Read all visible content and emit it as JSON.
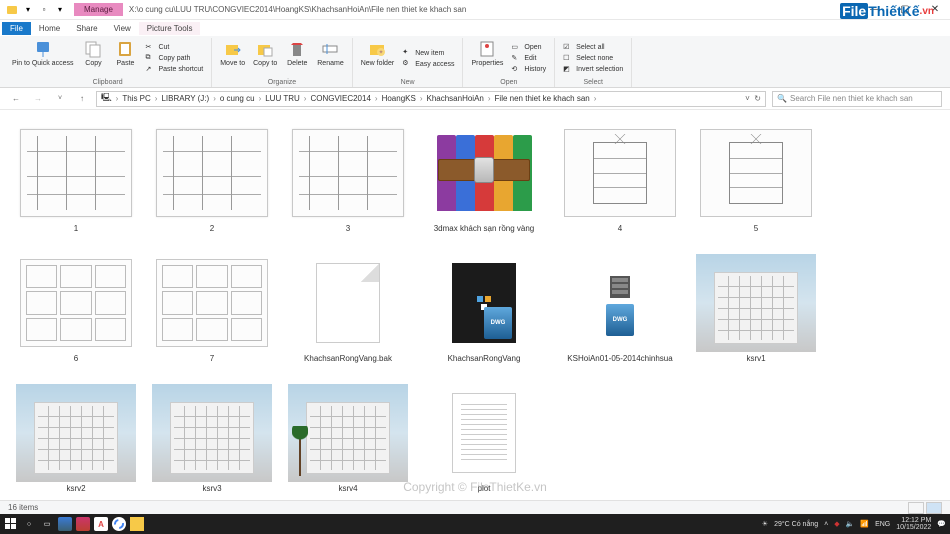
{
  "window": {
    "title_path": "X:\\o cung cu\\LUU TRU\\CONGVIEC2014\\HoangKS\\KhachsanHoiAn\\File nen thiet ke khach san",
    "ctx_tab": "Manage"
  },
  "ribbon": {
    "tabs": {
      "file": "File",
      "home": "Home",
      "share": "Share",
      "view": "View",
      "picture": "Picture Tools"
    },
    "pin": "Pin to Quick access",
    "copy": "Copy",
    "paste": "Paste",
    "cut": "Cut",
    "copypath": "Copy path",
    "pasteshortcut": "Paste shortcut",
    "clipboard": "Clipboard",
    "moveto": "Move to",
    "copyto": "Copy to",
    "delete": "Delete",
    "rename": "Rename",
    "organize": "Organize",
    "newfolder": "New folder",
    "newitem": "New item",
    "easyaccess": "Easy access",
    "new": "New",
    "properties": "Properties",
    "open": "Open",
    "edit": "Edit",
    "history": "History",
    "openg": "Open",
    "selectall": "Select all",
    "selectnone": "Select none",
    "invert": "Invert selection",
    "select": "Select"
  },
  "breadcrumb": {
    "root": "This PC",
    "parts": [
      "LIBRARY (J:)",
      "o cung cu",
      "LUU TRU",
      "CONGVIEC2014",
      "HoangKS",
      "KhachsanHoiAn",
      "File nen thiet ke khach san"
    ]
  },
  "search": {
    "placeholder": "Search File nen thiet ke khach san"
  },
  "files": [
    {
      "name": "1",
      "kind": "plan"
    },
    {
      "name": "2",
      "kind": "plan"
    },
    {
      "name": "3",
      "kind": "plan"
    },
    {
      "name": "3dmax khách sạn rồng vàng",
      "kind": "winrar"
    },
    {
      "name": "4",
      "kind": "elev"
    },
    {
      "name": "5",
      "kind": "elev"
    },
    {
      "name": "6",
      "kind": "grid"
    },
    {
      "name": "7",
      "kind": "grid"
    },
    {
      "name": "KhachsanRongVang.bak",
      "kind": "bak"
    },
    {
      "name": "KhachsanRongVang",
      "kind": "dwgdark"
    },
    {
      "name": "KSHoiAn01-05-2014chinhsua",
      "kind": "dwg"
    },
    {
      "name": "ksrv1",
      "kind": "render"
    },
    {
      "name": "ksrv2",
      "kind": "render"
    },
    {
      "name": "ksrv3",
      "kind": "render"
    },
    {
      "name": "ksrv4",
      "kind": "renderpalm"
    },
    {
      "name": "plot",
      "kind": "plot"
    }
  ],
  "status": {
    "count": "16 items"
  },
  "taskbar": {
    "weather": "29°C  Có nắng",
    "lang": "ENG",
    "time": "12:12 PM",
    "date": "10/15/2022"
  },
  "watermark": {
    "logo1": "File",
    "logo2": "ThiếtKế",
    "logo3": ".vn",
    "center": "Copyright © FileThietKe.vn"
  }
}
